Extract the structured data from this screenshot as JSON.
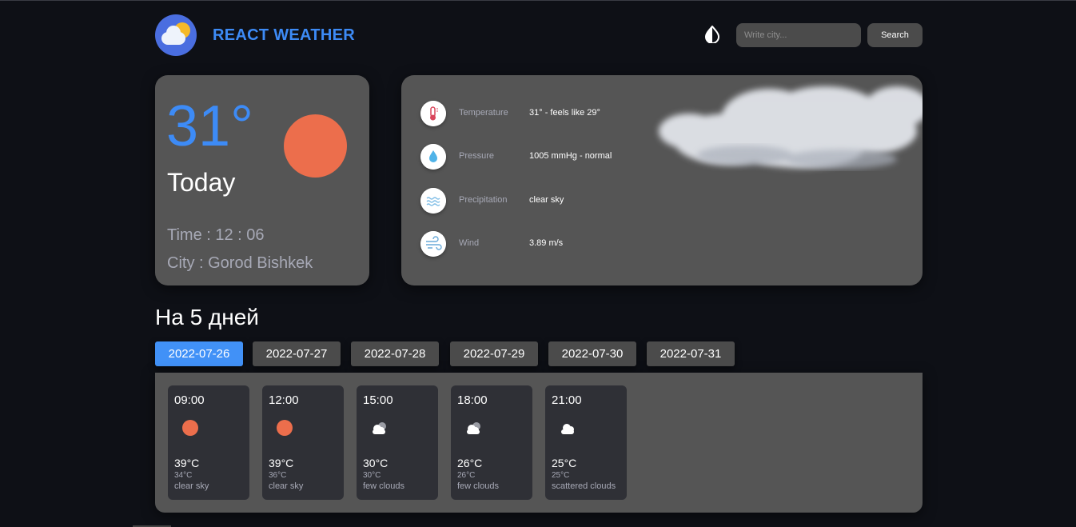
{
  "header": {
    "brand": "REACT WEATHER",
    "search_placeholder": "Write city...",
    "search_button": "Search"
  },
  "today": {
    "temp": "31°",
    "label": "Today",
    "time": "Time : 12 : 06",
    "city": "City : Gorod Bishkek",
    "icon": "sun-icon",
    "sun_color": "#ec6e4c"
  },
  "details": [
    {
      "icon": "thermometer-icon",
      "label": "Temperature",
      "value": "31° - feels like 29°"
    },
    {
      "icon": "drop-icon",
      "label": "Pressure",
      "value": "1005 mmHg - normal"
    },
    {
      "icon": "precipitation-icon",
      "label": "Precipitation",
      "value": "clear sky"
    },
    {
      "icon": "wind-icon",
      "label": "Wind",
      "value": "3.89 m/s"
    }
  ],
  "forecast": {
    "title": "На 5 дней",
    "tabs": [
      "2022-07-26",
      "2022-07-27",
      "2022-07-28",
      "2022-07-29",
      "2022-07-30",
      "2022-07-31"
    ],
    "active_tab": "2022-07-26",
    "hours": [
      {
        "time": "09:00",
        "icon": "sun-icon",
        "temp": "39°C",
        "feels": "34°C",
        "desc": "clear sky"
      },
      {
        "time": "12:00",
        "icon": "sun-icon",
        "temp": "39°C",
        "feels": "36°C",
        "desc": "clear sky"
      },
      {
        "time": "15:00",
        "icon": "few-clouds-icon",
        "temp": "30°C",
        "feels": "30°C",
        "desc": "few clouds"
      },
      {
        "time": "18:00",
        "icon": "few-clouds-icon",
        "temp": "26°C",
        "feels": "26°C",
        "desc": "few clouds"
      },
      {
        "time": "21:00",
        "icon": "cloud-icon",
        "temp": "25°C",
        "feels": "25°C",
        "desc": "scattered clouds"
      }
    ]
  },
  "colors": {
    "accent": "#3d8bf6",
    "card": "#555555",
    "background": "#0e1016",
    "hour_card": "#2f3036",
    "active_tab": "#4191f7"
  }
}
